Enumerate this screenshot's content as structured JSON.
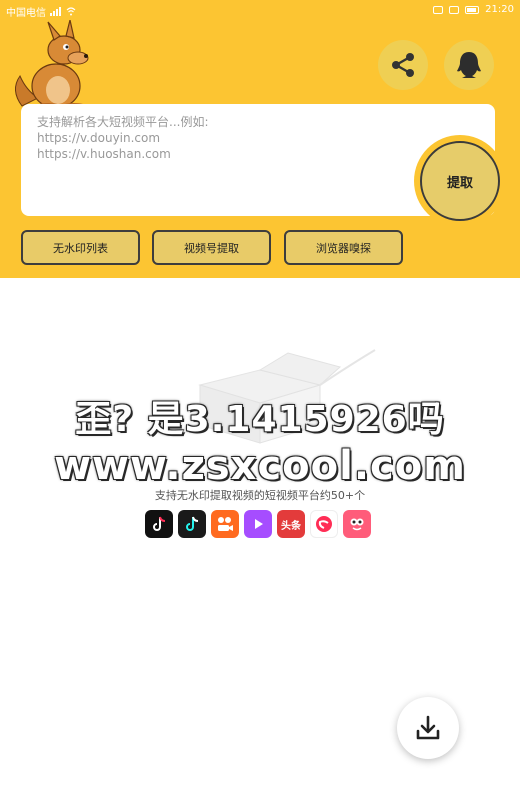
{
  "status_bar": {
    "carrier": "中国电信",
    "time": "21:20"
  },
  "colors": {
    "header_bg": "#fcc532",
    "button_bg": "#e8cb68",
    "border": "#3d3d3d"
  },
  "header": {
    "mascot": "kangaroo-mascot",
    "share_icon": "share-icon",
    "qq_icon": "qq-penguin-icon"
  },
  "input": {
    "placeholder": "支持解析各大短视频平台...例如:\nhttps://v.douyin.com\nhttps://v.huoshan.com"
  },
  "extract_label": "提取",
  "actions": [
    {
      "label": "无水印列表"
    },
    {
      "label": "视频号提取"
    },
    {
      "label": "浏览器嗅探"
    }
  ],
  "watermark": {
    "line1": "歪?  是3.1415926吗",
    "line2": "www.zsxcool.com"
  },
  "support_text": "支持无水印提取视频的短视频平台约50+个",
  "platforms": [
    {
      "icon": "douyin-icon",
      "color": "#111111"
    },
    {
      "icon": "douyin-lite-icon",
      "color": "#1a1a1a"
    },
    {
      "icon": "kuaishou-icon",
      "color": "#ff6a1f"
    },
    {
      "icon": "weishi-icon",
      "color": "#a64dff"
    },
    {
      "icon": "toutiao-icon",
      "color": "#e33b3b",
      "text": "头条"
    },
    {
      "icon": "pipixia-icon",
      "color": "#ff2d55"
    },
    {
      "icon": "xigua-icon",
      "color": "#ff5c7a"
    }
  ],
  "download_icon": "download-icon"
}
